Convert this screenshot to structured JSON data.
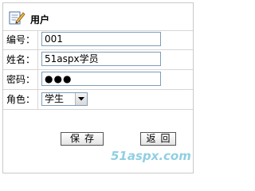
{
  "header": {
    "title": "用户",
    "icon": "edit-document-icon"
  },
  "form": {
    "fields": [
      {
        "label": "编号：",
        "value": "001"
      },
      {
        "label": "姓名：",
        "value": "51aspx学员"
      },
      {
        "label": "密码：",
        "value": "●●●"
      },
      {
        "label": "角色：",
        "value": "学生"
      }
    ]
  },
  "buttons": {
    "save": "保存",
    "back": "返回"
  },
  "watermark": "51aspx.com"
}
